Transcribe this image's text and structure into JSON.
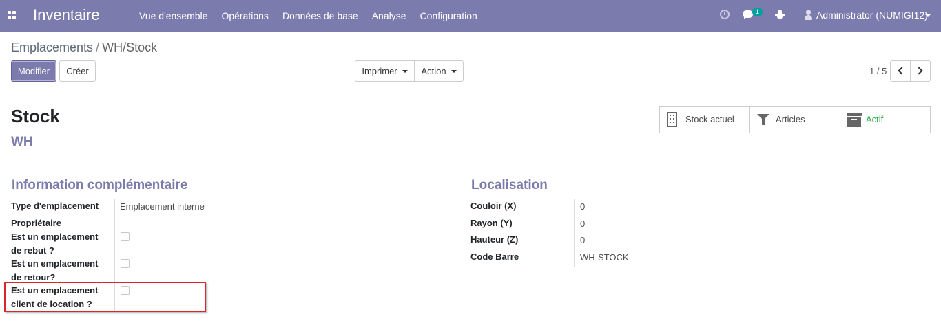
{
  "navbar": {
    "app_title": "Inventaire",
    "menu": [
      "Vue d'ensemble",
      "Opérations",
      "Données de base",
      "Analyse",
      "Configuration"
    ],
    "notification_count": "1",
    "user_name": "Administrator (NUMIGI12)",
    "bar_color": "#7c7bad"
  },
  "control_panel": {
    "breadcrumb_parent": "Emplacements",
    "breadcrumb_separator": "/",
    "breadcrumb_current": "WH/Stock",
    "edit_label": "Modifier",
    "create_label": "Créer",
    "print_label": "Imprimer",
    "action_label": "Action",
    "pager": "1 / 5"
  },
  "form": {
    "title": "Stock",
    "subtitle": "WH",
    "smart_buttons": [
      {
        "label": "Stock actuel",
        "icon": "building-icon"
      },
      {
        "label": "Articles",
        "icon": "filter-icon"
      },
      {
        "label": "Actif",
        "icon": "archive-icon",
        "color": "#28a745"
      }
    ],
    "left_section": {
      "title": "Information complémentaire",
      "type_label": "Type d'emplacement",
      "type_value": "Emplacement interne",
      "owner_label": "Propriétaire",
      "scrap_label": "Est un emplacement de rebut ?",
      "scrap_checked": false,
      "return_label": "Est un emplacement de retour?",
      "return_checked": false,
      "rental_label": "Est un emplacement client de location ?",
      "rental_checked": false
    },
    "right_section": {
      "title": "Localisation",
      "fields": [
        {
          "label": "Couloir (X)",
          "value": "0"
        },
        {
          "label": "Rayon (Y)",
          "value": "0"
        },
        {
          "label": "Hauteur (Z)",
          "value": "0"
        },
        {
          "label": "Code Barre",
          "value": "WH-STOCK"
        }
      ]
    }
  },
  "annotation_color": "#d9262c"
}
